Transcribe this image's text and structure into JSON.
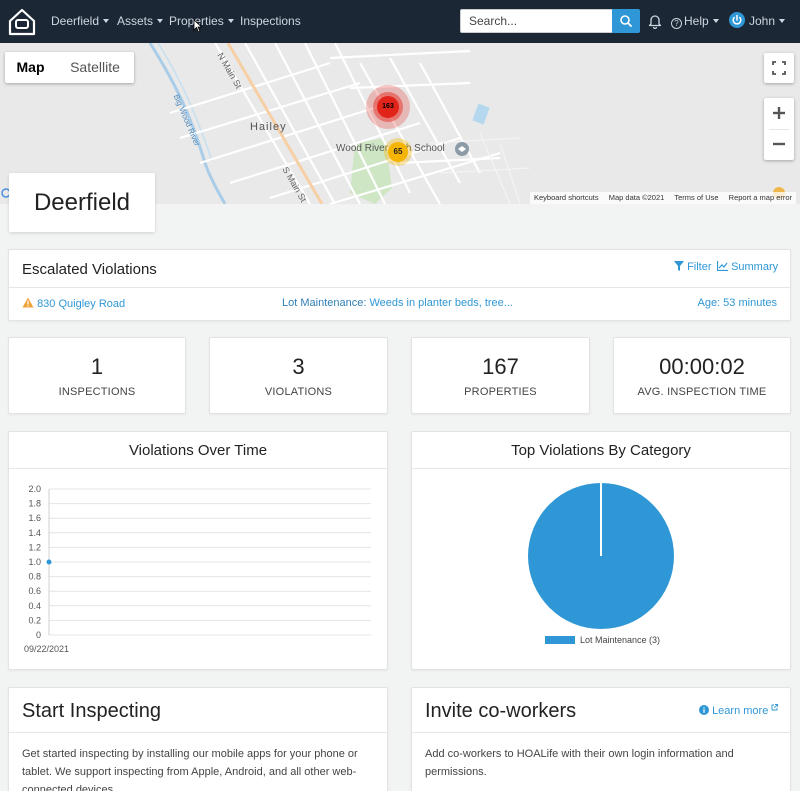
{
  "navbar": {
    "menus": [
      {
        "label": "Deerfield",
        "caret": true
      },
      {
        "label": "Assets",
        "caret": true
      },
      {
        "label": "Properties",
        "caret": true
      },
      {
        "label": "Inspections",
        "caret": false
      }
    ],
    "search_placeholder": "Search...",
    "help_label": "Help",
    "user_name": "John",
    "brand_color": "#1b2735",
    "accent_color": "#2f97d6"
  },
  "map": {
    "type_tabs": [
      "Map",
      "Satellite"
    ],
    "selected_tab": "Map",
    "labels": {
      "city": "Hailey",
      "street_north": "N Main St",
      "street_south": "S Main St",
      "river": "Big Wood River",
      "school": "Wood River High School"
    },
    "clusters": [
      {
        "count": "163",
        "color": "#e2231a"
      },
      {
        "count": "65",
        "color": "#f4b400"
      }
    ],
    "attribution": [
      "Keyboard shortcuts",
      "Map data ©2021",
      "Terms of Use",
      "Report a map error"
    ]
  },
  "property": {
    "name": "Deerfield"
  },
  "escalated": {
    "title": "Escalated Violations",
    "filter_label": "Filter",
    "summary_label": "Summary",
    "row": {
      "address": "830 Quigley Road",
      "category": "Lot Maintenance:",
      "description": "Weeds in planter beds, tree...",
      "age": "Age: 53 minutes"
    }
  },
  "stats": [
    {
      "value": "1",
      "label": "INSPECTIONS"
    },
    {
      "value": "3",
      "label": "VIOLATIONS"
    },
    {
      "value": "167",
      "label": "PROPERTIES"
    },
    {
      "value": "00:00:02",
      "label": "AVG. INSPECTION TIME"
    }
  ],
  "charts": {
    "violations_title": "Violations Over Time",
    "category_title": "Top Violations By Category"
  },
  "chart_data": [
    {
      "type": "line",
      "title": "Violations Over Time",
      "x": [
        "09/22/2021"
      ],
      "series": [
        {
          "values": [
            1.0
          ]
        }
      ],
      "ylim": [
        0,
        2.0
      ],
      "yticks": [
        "2.0",
        "1.8",
        "1.6",
        "1.4",
        "1.2",
        "1.0",
        "0.8",
        "0.6",
        "0.4",
        "0.2",
        "0"
      ],
      "grid": true,
      "color": "#2f97d6"
    },
    {
      "type": "pie",
      "title": "Top Violations By Category",
      "slices": [
        {
          "label": "Lot Maintenance (3)",
          "value": 3
        }
      ],
      "legend": "bottom",
      "color": "#2f97d6"
    }
  ],
  "start_inspecting": {
    "title": "Start Inspecting",
    "text_lines": [
      "Get started inspecting by installing our mobile apps for your phone or",
      "tablet. We support inspecting from Apple, Android, and all other web-",
      "connected devices."
    ]
  },
  "invite": {
    "title": "Invite co-workers",
    "learn_more": "Learn more",
    "text_lines": [
      "Add co-workers to HOALife with their own login information and",
      "permissions."
    ]
  }
}
